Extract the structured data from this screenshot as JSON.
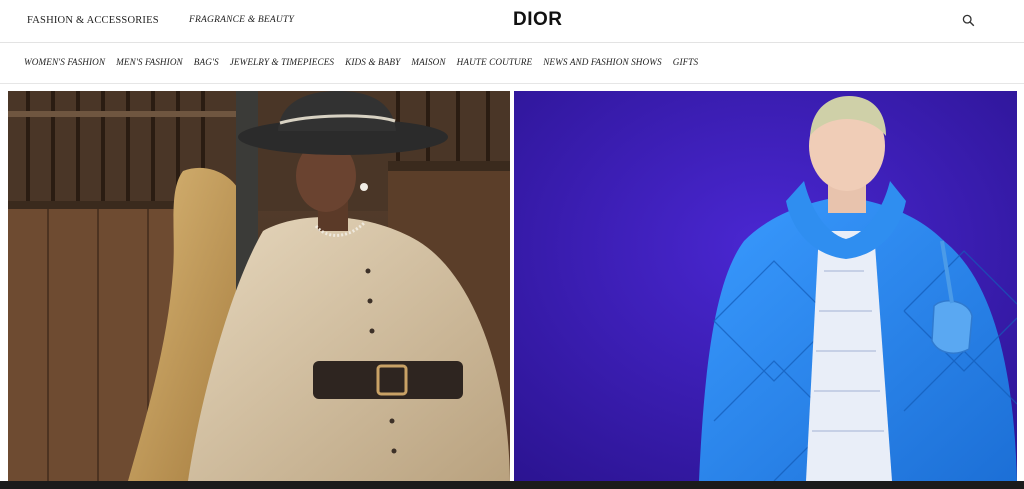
{
  "header": {
    "fashion_link": "FASHION & ACCESSORIES",
    "fragrance_link": "FRAGRANCE & BEAUTY",
    "logo": "DIOR",
    "search_icon": "search-icon"
  },
  "nav": {
    "items": [
      "WOMEN'S FASHION",
      "MEN'S FASHION",
      "BAG'S",
      "JEWELRY & TIMEPIECES",
      "KIDS & BABY",
      "MAISON",
      "HAUTE COUTURE",
      "NEWS AND FASHION SHOWS",
      "GIFTS"
    ]
  },
  "colors": {
    "right_background": "#3a1db8",
    "jacket_blue": "#2f8ef0",
    "stable_brown": "#6b4e35"
  }
}
